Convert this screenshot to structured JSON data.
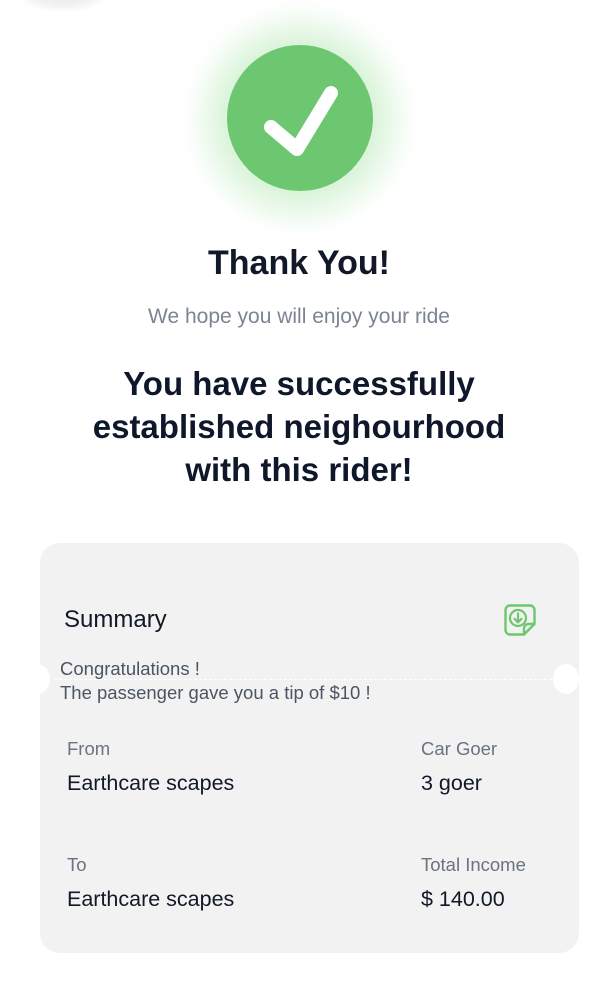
{
  "header": {
    "check_icon": "checkmark-icon",
    "accent_color": "#6dc771",
    "title": "Thank You!",
    "subtitle": "We hope you will enjoy your ride",
    "headline_lines": [
      "You have successfully",
      "established neighourhood",
      "with this rider!"
    ]
  },
  "summary": {
    "title": "Summary",
    "download_icon": "download-note-icon",
    "congrats_lines": [
      "Congratulations !",
      "The passenger gave you a tip of $10 !"
    ],
    "from_label": "From",
    "from_value": "Earthcare scapes",
    "car_label": "Car Goer",
    "car_value": "3 goer",
    "to_label": "To",
    "to_value": "Earthcare scapes",
    "income_label": "Total Income",
    "income_value": "$ 140.00"
  }
}
